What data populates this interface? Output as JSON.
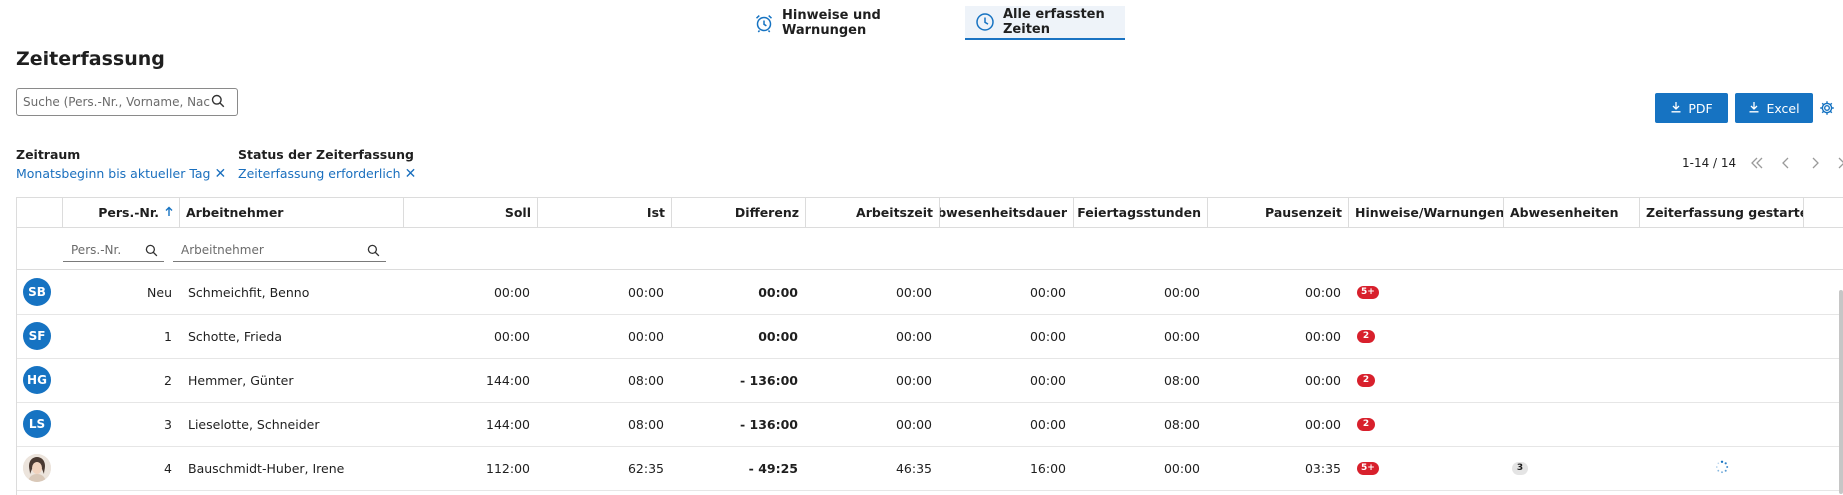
{
  "tabs": [
    {
      "label": "Hinweise und Warnungen",
      "icon": "alarm-clock-icon"
    },
    {
      "label": "Alle erfassten Zeiten",
      "icon": "clock-icon",
      "active": true
    }
  ],
  "page_title": "Zeiterfassung",
  "search": {
    "placeholder": "Suche (Pers.-Nr., Vorname, Nach..."
  },
  "buttons": {
    "pdf": "PDF",
    "excel": "Excel"
  },
  "filters": [
    {
      "label": "Zeitraum",
      "value": "Monatsbeginn bis aktueller Tag"
    },
    {
      "label": "Status der Zeiterfassung",
      "value": "Zeiterfassung erforderlich"
    }
  ],
  "pager": {
    "count": "1-14 / 14"
  },
  "columns": {
    "persnr": "Pers.-Nr.",
    "arbeitnehmer": "Arbeitnehmer",
    "soll": "Soll",
    "ist": "Ist",
    "differenz": "Differenz",
    "arbeitszeit": "Arbeitszeit",
    "abwesenheitsdauer": "Abwesenheitsdauer",
    "feiertagsstunden": "Feiertagsstunden",
    "pausenzeit": "Pausenzeit",
    "hinweise": "Hinweise/Warnungen",
    "abwesenheiten": "Abwesenheiten",
    "gestartet": "Zeiterfassung gestartet"
  },
  "column_filters": {
    "persnr_placeholder": "Pers.-Nr.",
    "arbeitnehmer_placeholder": "Arbeitnehmer"
  },
  "rows": [
    {
      "avatar": "SB",
      "persnr": "Neu",
      "name": "Schmeichfit, Benno",
      "soll": "00:00",
      "ist": "00:00",
      "differenz": "00:00",
      "arbeitszeit": "00:00",
      "abwesenheitsdauer": "00:00",
      "feiertagsstunden": "00:00",
      "pausenzeit": "00:00",
      "hinweise": "5+",
      "abwesenheiten": "",
      "gestartet": false
    },
    {
      "avatar": "SF",
      "persnr": "1",
      "name": "Schotte, Frieda",
      "soll": "00:00",
      "ist": "00:00",
      "differenz": "00:00",
      "arbeitszeit": "00:00",
      "abwesenheitsdauer": "00:00",
      "feiertagsstunden": "00:00",
      "pausenzeit": "00:00",
      "hinweise": "2",
      "abwesenheiten": "",
      "gestartet": false
    },
    {
      "avatar": "HG",
      "persnr": "2",
      "name": "Hemmer, Günter",
      "soll": "144:00",
      "ist": "08:00",
      "differenz": "- 136:00",
      "arbeitszeit": "00:00",
      "abwesenheitsdauer": "00:00",
      "feiertagsstunden": "08:00",
      "pausenzeit": "00:00",
      "hinweise": "2",
      "abwesenheiten": "",
      "gestartet": false
    },
    {
      "avatar": "LS",
      "persnr": "3",
      "name": "Lieselotte, Schneider",
      "soll": "144:00",
      "ist": "08:00",
      "differenz": "- 136:00",
      "arbeitszeit": "00:00",
      "abwesenheitsdauer": "00:00",
      "feiertagsstunden": "08:00",
      "pausenzeit": "00:00",
      "hinweise": "2",
      "abwesenheiten": "",
      "gestartet": false
    },
    {
      "avatar": "",
      "persnr": "4",
      "name": "Bauschmidt-Huber, Irene",
      "soll": "112:00",
      "ist": "62:35",
      "differenz": "- 49:25",
      "arbeitszeit": "46:35",
      "abwesenheitsdauer": "16:00",
      "feiertagsstunden": "00:00",
      "pausenzeit": "03:35",
      "hinweise": "5+",
      "abwesenheiten": "3",
      "gestartet": true
    }
  ],
  "colors": {
    "primary": "#1673c2",
    "link": "#1a6fbe",
    "warning_badge": "#d8202c",
    "active_tab_bg": "#eef3f9"
  }
}
